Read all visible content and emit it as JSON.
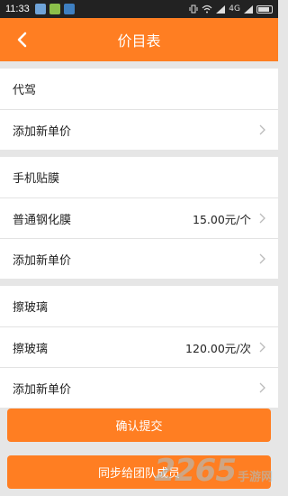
{
  "status_bar": {
    "time": "11:33",
    "network": "4G"
  },
  "header": {
    "title": "价目表",
    "back_icon": "chevron-left-icon"
  },
  "groups": [
    {
      "name": "代驾",
      "items": [
        {
          "label": "添加新单价",
          "value": ""
        }
      ]
    },
    {
      "name": "手机贴膜",
      "items": [
        {
          "label": "普通钢化膜",
          "value": "15.00元/个"
        },
        {
          "label": "添加新单价",
          "value": ""
        }
      ]
    },
    {
      "name": "擦玻璃",
      "items": [
        {
          "label": "擦玻璃",
          "value": "120.00元/次"
        },
        {
          "label": "添加新单价",
          "value": ""
        }
      ]
    }
  ],
  "buttons": {
    "confirm": "确认提交",
    "sync": "同步给团队成员"
  },
  "watermark": {
    "number": "2265",
    "suffix": "手游网"
  },
  "colors": {
    "accent": "#ff7e22",
    "background": "#e6e6e6",
    "chevron": "#bbbbbb"
  }
}
